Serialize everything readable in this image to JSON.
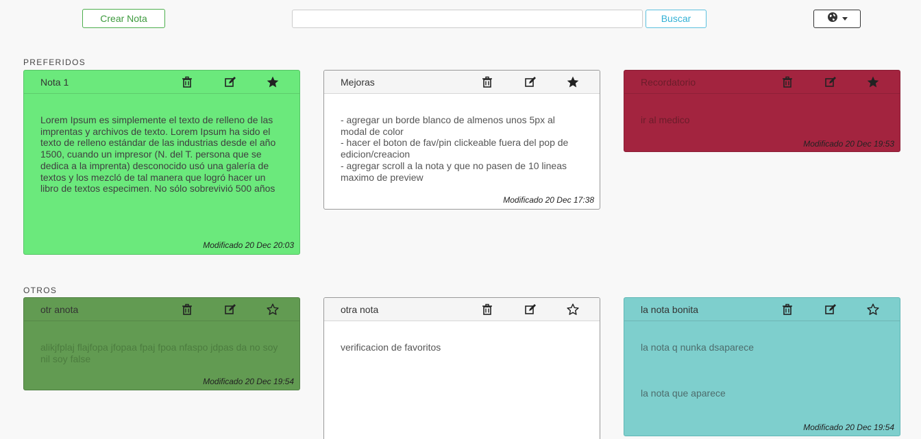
{
  "toolbar": {
    "create_label": "Crear Nota",
    "search_value": "",
    "search_placeholder": "",
    "search_label": "Buscar",
    "language_icon": "globe-icon"
  },
  "sections": {
    "favorites": "PREFERIDOS",
    "others": "OTROS"
  },
  "notes": [
    {
      "title": "Nota 1",
      "body": [
        "Lorem Ipsum es simplemente el texto de relleno de las imprentas y archivos de texto. Lorem Ipsum ha sido el texto de relleno estándar de las industrias desde el año 1500, cuando un impresor (N. del T. persona que se dedica a la imprenta) desconocido usó una galería de textos y los mezcló de tal manera que logró hacer un libro de textos especimen. No sólo sobrevivió 500 años"
      ],
      "modified": "Modificado 20 Dec 20:03",
      "favorite": true,
      "color": "#6be97c"
    },
    {
      "title": "Mejoras",
      "body": [
        "- agregar un borde blanco de almenos unos 5px al modal de color",
        "- hacer el boton de fav/pin clickeable fuera del pop de edicion/creacion",
        "- agregar scroll a la nota y que no pasen de 10 lineas maximo de preview"
      ],
      "modified": "Modificado 20 Dec 17:38",
      "favorite": true,
      "color": "#ffffff"
    },
    {
      "title": "Recordatorio",
      "body": [
        "ir al medico"
      ],
      "modified": "Modificado 20 Dec 19:53",
      "favorite": true,
      "color": "#a3243f"
    },
    {
      "title": "otr anota",
      "body": [
        "alikjfplaj flajfopa jfopaa fpaj fpoa nfaspo jdpas da no soy nil soy false"
      ],
      "modified": "Modificado 20 Dec 19:54",
      "favorite": false,
      "color": "#629b52"
    },
    {
      "title": "otra nota",
      "body": [
        "verificacion de favoritos"
      ],
      "modified": "",
      "favorite": false,
      "color": "#ffffff"
    },
    {
      "title": "la nota bonita",
      "body": [
        "la nota q nunka dsaparece",
        "la nota que aparece"
      ],
      "modified": "Modificado 20 Dec 19:54",
      "favorite": false,
      "color": "#7ecfcd"
    }
  ]
}
